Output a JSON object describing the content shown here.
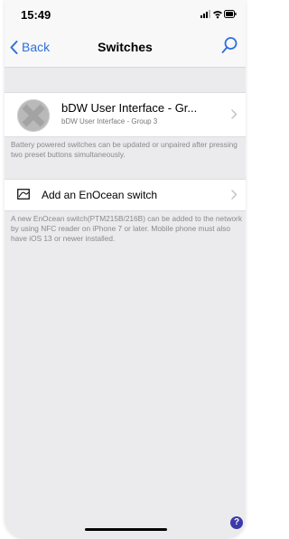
{
  "status_bar": {
    "time": "15:49",
    "icons": [
      "signal-icon",
      "wifi-icon",
      "battery-icon"
    ]
  },
  "nav_bar": {
    "back_label": "Back",
    "title": "Switches",
    "search_icon": "search-icon",
    "accent_color": "#2f6fde"
  },
  "device": {
    "title": "bDW User Interface - Gr...",
    "subtitle": "bDW User Interface - Group 3",
    "note": "Battery powered switches can be updated or unpaired after pressing two preset buttons simultaneously."
  },
  "add_switch": {
    "label": "Add an EnOcean switch",
    "note": "A new EnOcean switch(PTM215B/216B) can be added to the network by using NFC reader on iPhone 7 or later. Mobile phone must also have iOS 13 or newer installed."
  },
  "help_button": {
    "label": "?",
    "color": "#3c3aa9"
  }
}
